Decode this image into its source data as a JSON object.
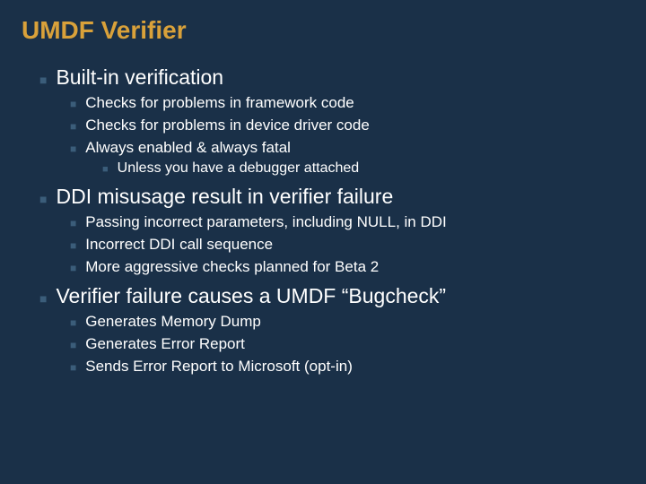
{
  "title": "UMDF Verifier",
  "sections": [
    {
      "heading": "Built-in verification",
      "items": [
        {
          "text": "Checks for problems in framework code"
        },
        {
          "text": "Checks for problems in device driver code"
        },
        {
          "text": "Always enabled & always fatal",
          "subitems": [
            {
              "text": "Unless you have a debugger attached"
            }
          ]
        }
      ]
    },
    {
      "heading": "DDI misusage result in verifier failure",
      "items": [
        {
          "text": "Passing incorrect parameters, including NULL, in DDI"
        },
        {
          "text": "Incorrect DDI call sequence"
        },
        {
          "text": "More aggressive checks planned for Beta 2"
        }
      ]
    },
    {
      "heading": "Verifier failure causes a UMDF “Bugcheck”",
      "items": [
        {
          "text": "Generates Memory Dump"
        },
        {
          "text": "Generates Error Report"
        },
        {
          "text": "Sends Error Report to Microsoft (opt-in)"
        }
      ]
    }
  ],
  "bullet_glyphs": {
    "level1": "■",
    "level2": "■",
    "level3": "■"
  }
}
